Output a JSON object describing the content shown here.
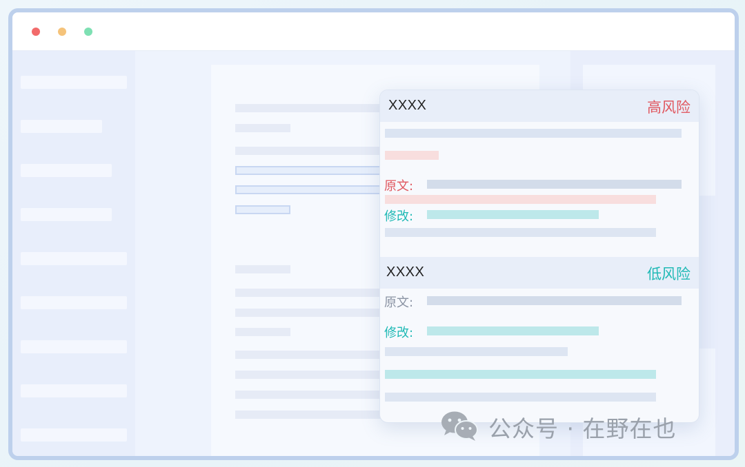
{
  "window": {
    "controls": [
      "close",
      "minimize",
      "maximize"
    ],
    "colors": {
      "close": "#f26b6b",
      "minimize": "#f5c37a",
      "maximize": "#7ee0b3"
    }
  },
  "popup": {
    "items": [
      {
        "title": "XXXX",
        "risk_label": "高风险",
        "risk_color": "#e0575f",
        "original_label": "原文:",
        "revision_label": "修改:"
      },
      {
        "title": "XXXX",
        "risk_label": "低风险",
        "risk_color": "#1fb9b5",
        "original_label": "原文:",
        "revision_label": "修改:"
      }
    ]
  },
  "watermark": {
    "icon": "wechat-icon",
    "text": "公众号 · 在野在也"
  }
}
